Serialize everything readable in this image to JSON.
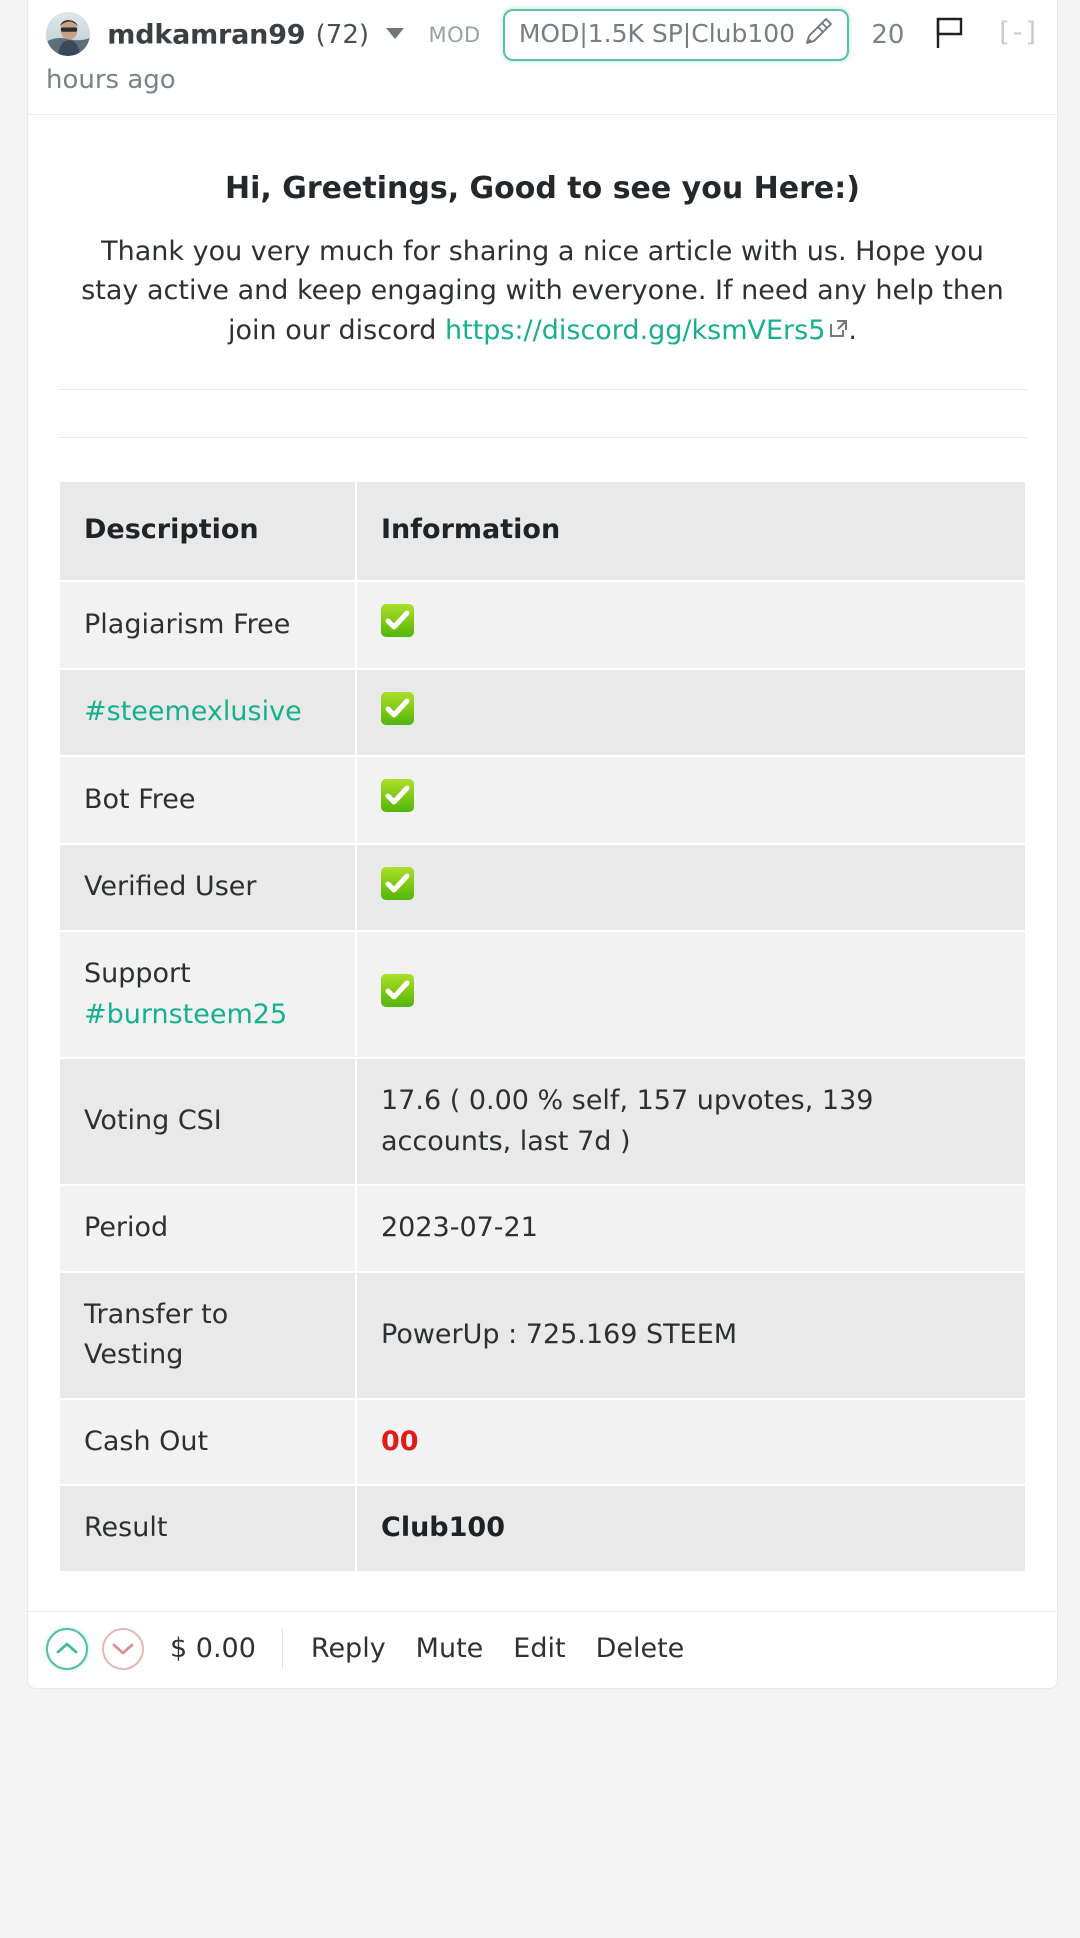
{
  "header": {
    "avatar_alt": "user-avatar",
    "author": "mdkamran99",
    "reputation": "(72)",
    "mod_tag": "MOD",
    "badge_text": "MOD|1.5K SP|Club100",
    "badge_icon": "pencil-icon",
    "timestamp": "20 hours ago",
    "flag_icon": "flag-icon",
    "collapse_label": "[-]"
  },
  "body": {
    "greeting_title": "Hi, Greetings, Good to see you Here:)",
    "paragraph_before": "Thank you very much for sharing a nice article with us. Hope you stay active and keep engaging with everyone. If need any help then join our discord ",
    "discord_url": "https://discord.gg/ksmVErs5",
    "paragraph_after": "."
  },
  "table": {
    "columns": [
      "Description",
      "Information"
    ],
    "rows": [
      {
        "description": "Plagiarism Free",
        "desc_is_tag": false,
        "value": "",
        "value_type": "check"
      },
      {
        "description": "#steemexlusive",
        "desc_is_tag": true,
        "value": "",
        "value_type": "check"
      },
      {
        "description": "Bot Free",
        "desc_is_tag": false,
        "value": "",
        "value_type": "check"
      },
      {
        "description": "Verified User",
        "desc_is_tag": false,
        "value": "",
        "value_type": "check"
      },
      {
        "description": "Support",
        "desc_sub": "#burnsteem25",
        "desc_is_tag": false,
        "value": "",
        "value_type": "check"
      },
      {
        "description": "Voting CSI",
        "desc_is_tag": false,
        "value": "17.6 ( 0.00 % self, 157 upvotes, 139 accounts, last 7d )",
        "value_type": "text"
      },
      {
        "description": "Period",
        "desc_is_tag": false,
        "value": "2023-07-21",
        "value_type": "text"
      },
      {
        "description": "Transfer to Vesting",
        "desc_is_tag": false,
        "value": "PowerUp : 725.169 STEEM",
        "value_type": "text"
      },
      {
        "description": "Cash Out",
        "desc_is_tag": false,
        "value": "00",
        "value_type": "red"
      },
      {
        "description": "Result",
        "desc_is_tag": false,
        "value": "Club100",
        "value_type": "bold"
      }
    ]
  },
  "footer": {
    "upvote_icon": "chevron-up-icon",
    "downvote_icon": "chevron-down-icon",
    "payout": "$ 0.00",
    "actions": [
      "Reply",
      "Mute",
      "Edit",
      "Delete"
    ]
  },
  "colors": {
    "accent_teal": "#16b08c",
    "badge_border": "#5bc0a4",
    "red": "#e01b1b",
    "check_green": "#52b50b",
    "row_odd": "#f2f2f2",
    "row_even": "#e9e9e9"
  }
}
